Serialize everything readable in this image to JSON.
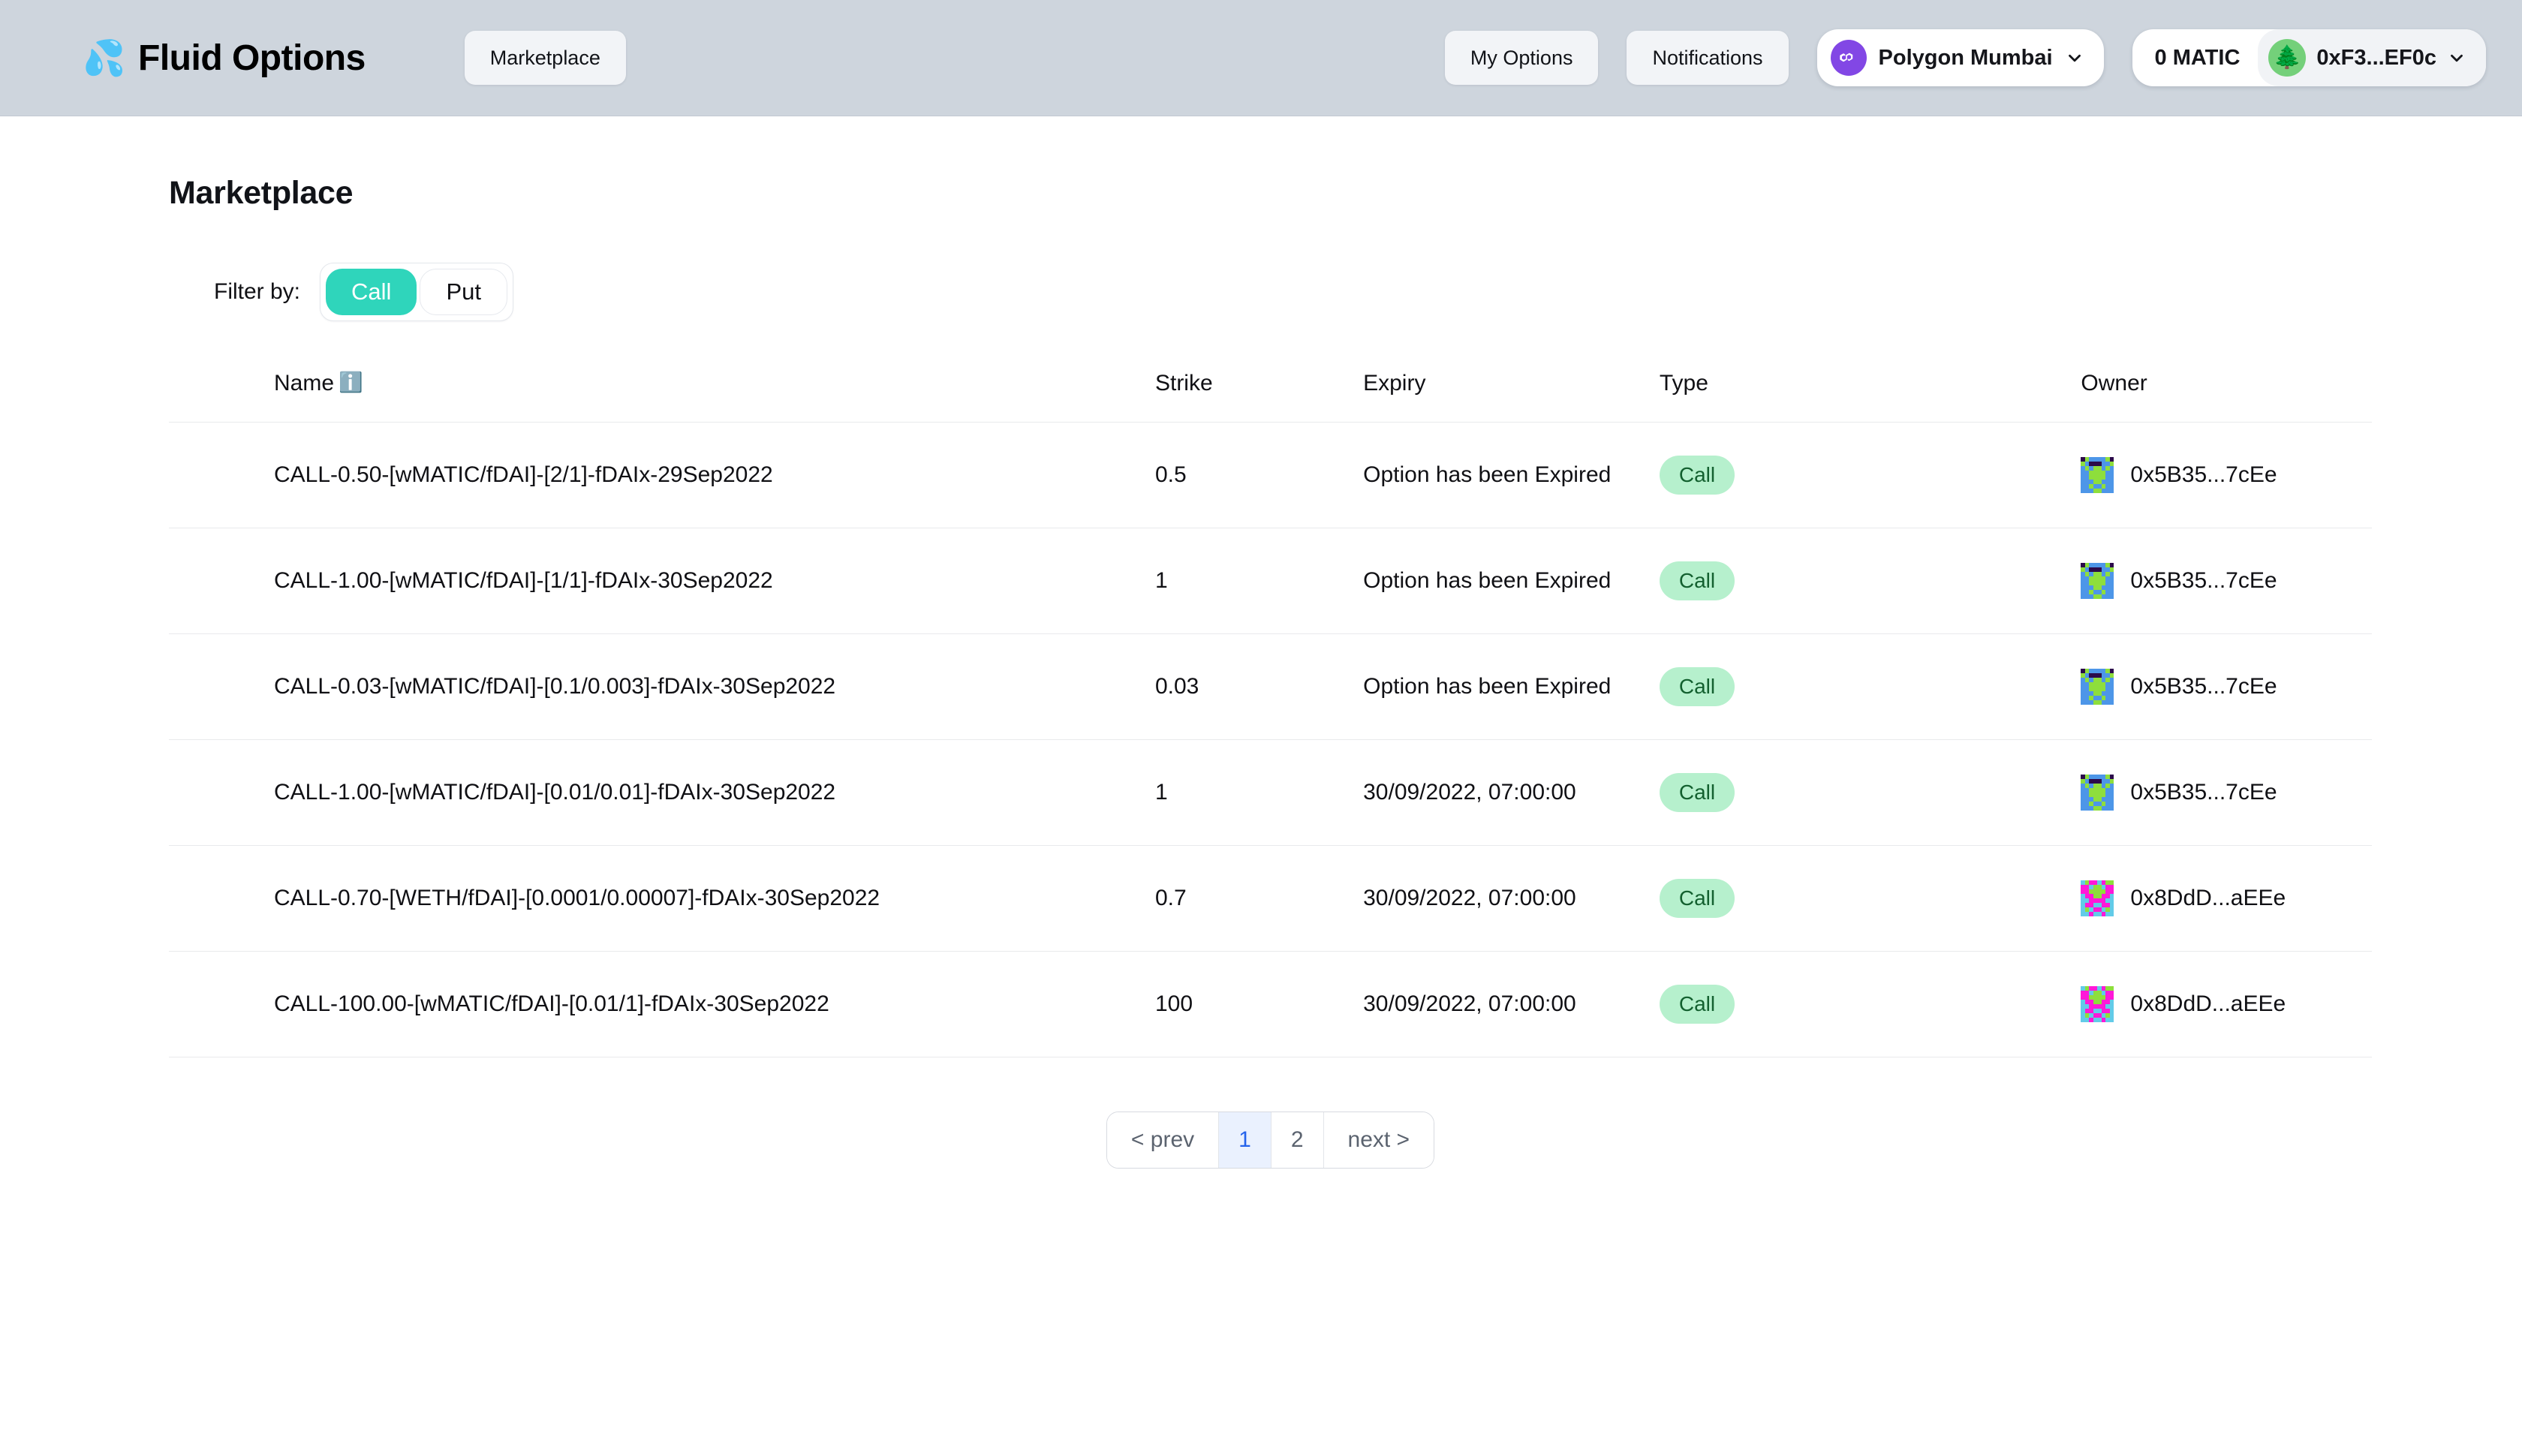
{
  "header": {
    "brand": {
      "logo_icon": "water-droplets-icon",
      "logo_glyph": "💦",
      "name": "Fluid Options"
    },
    "nav": [
      {
        "id": "marketplace",
        "label": "Marketplace"
      },
      {
        "id": "my-options",
        "label": "My Options"
      },
      {
        "id": "notifications",
        "label": "Notifications"
      }
    ],
    "chain": {
      "icon": "polygon-icon",
      "label": "Polygon Mumbai",
      "chevron": "chevron-down-icon",
      "accent": "#8247e5"
    },
    "account": {
      "balance": "0 MATIC",
      "avatar_icon": "tree-avatar-icon",
      "avatar_glyph": "🌲",
      "avatar_bg": "#74d07a",
      "address": "0xF3...EF0c",
      "chevron": "chevron-down-icon"
    },
    "bg_color": "#ced5dd"
  },
  "main": {
    "title": "Marketplace",
    "filter": {
      "label": "Filter by:",
      "options": [
        {
          "id": "call",
          "label": "Call",
          "active": true
        },
        {
          "id": "put",
          "label": "Put",
          "active": false
        }
      ],
      "active_color": "#2fd5bb"
    },
    "table": {
      "columns": [
        {
          "id": "name",
          "label": "Name",
          "info_icon": "info-icon",
          "info_glyph": "ℹ️"
        },
        {
          "id": "strike",
          "label": "Strike"
        },
        {
          "id": "expiry",
          "label": "Expiry"
        },
        {
          "id": "type",
          "label": "Type"
        },
        {
          "id": "owner",
          "label": "Owner"
        }
      ],
      "rows": [
        {
          "name": "CALL-0.50-[wMATIC/fDAI]-[2/1]-fDAIx-29Sep2022",
          "strike": "0.5",
          "expiry": "Option has been Expired",
          "type": "Call",
          "owner": "0x5B35...7cEe",
          "avatar": "blue"
        },
        {
          "name": "CALL-1.00-[wMATIC/fDAI]-[1/1]-fDAIx-30Sep2022",
          "strike": "1",
          "expiry": "Option has been Expired",
          "type": "Call",
          "owner": "0x5B35...7cEe",
          "avatar": "blue"
        },
        {
          "name": "CALL-0.03-[wMATIC/fDAI]-[0.1/0.003]-fDAIx-30Sep2022",
          "strike": "0.03",
          "expiry": "Option has been Expired",
          "type": "Call",
          "owner": "0x5B35...7cEe",
          "avatar": "blue"
        },
        {
          "name": "CALL-1.00-[wMATIC/fDAI]-[0.01/0.01]-fDAIx-30Sep2022",
          "strike": "1",
          "expiry": "30/09/2022, 07:00:00",
          "type": "Call",
          "owner": "0x5B35...7cEe",
          "avatar": "blue"
        },
        {
          "name": "CALL-0.70-[WETH/fDAI]-[0.0001/0.00007]-fDAIx-30Sep2022",
          "strike": "0.7",
          "expiry": "30/09/2022, 07:00:00",
          "type": "Call",
          "owner": "0x8DdD...aEEe",
          "avatar": "pink"
        },
        {
          "name": "CALL-100.00-[wMATIC/fDAI]-[0.01/1]-fDAIx-30Sep2022",
          "strike": "100",
          "expiry": "30/09/2022, 07:00:00",
          "type": "Call",
          "owner": "0x8DdD...aEEe",
          "avatar": "pink"
        }
      ],
      "badge_bg": "#b6f0cd",
      "badge_fg": "#13602f"
    },
    "pagination": {
      "prev_label": "< prev",
      "next_label": "next >",
      "pages": [
        "1",
        "2"
      ],
      "current": "1",
      "current_color": "#2563eb"
    }
  }
}
